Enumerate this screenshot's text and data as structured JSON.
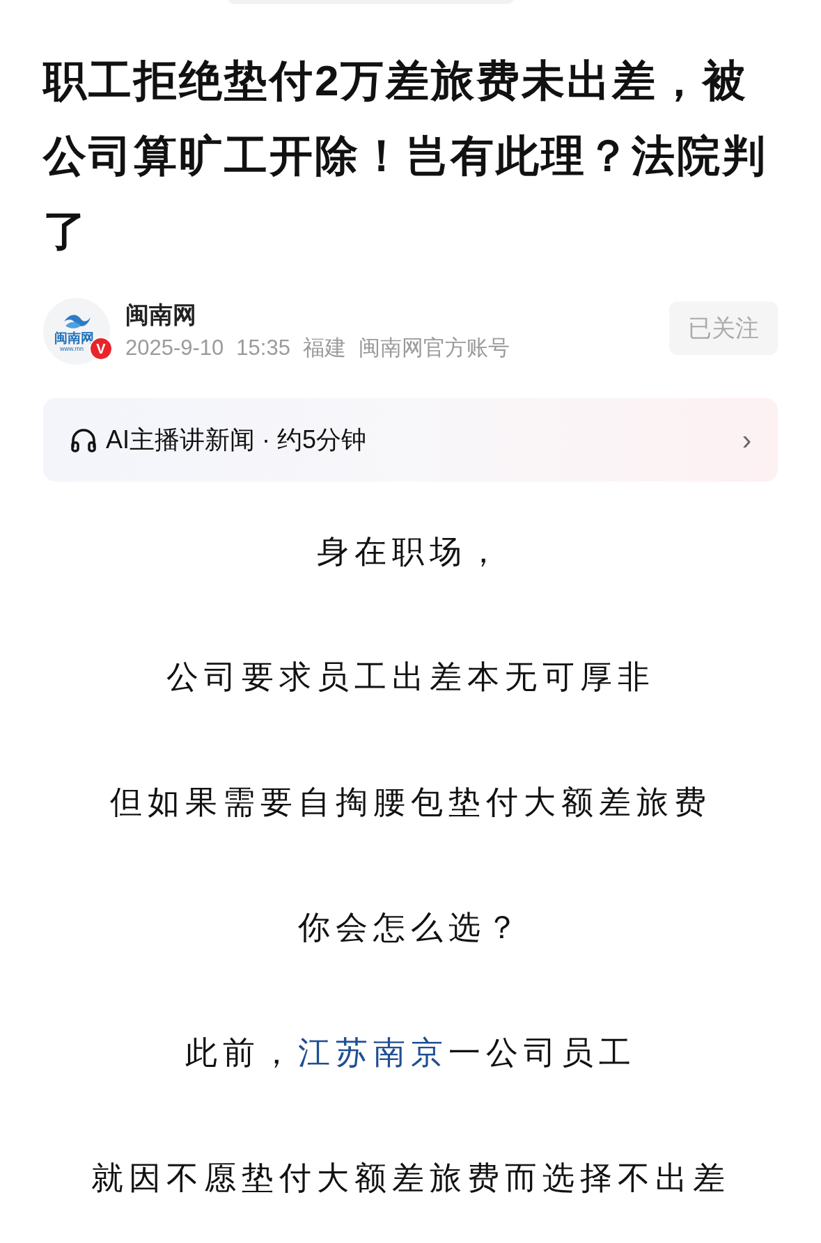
{
  "title": "职工拒绝垫付2万差旅费未出差，被公司算旷工开除！岂有此理？法院判了",
  "author": {
    "logo_text": "闽南网",
    "logo_url": "www.mn",
    "badge": "V",
    "name": "闽南网",
    "date": "2025-9-10",
    "time": "15:35",
    "region": "福建",
    "account": "闽南网官方账号",
    "follow_label": "已关注",
    "followed": true
  },
  "audio_bar": {
    "label": "AI主播讲新闻 · 约5分钟",
    "arrow": "›"
  },
  "paragraphs": [
    {
      "segments": [
        {
          "kind": "text",
          "text": "身在职场，"
        }
      ]
    },
    {
      "segments": [
        {
          "kind": "text",
          "text": "公司要求员工出差本无可厚非"
        }
      ]
    },
    {
      "segments": [
        {
          "kind": "text",
          "text": "但如果需要自掏腰包垫付大额差旅费"
        }
      ]
    },
    {
      "segments": [
        {
          "kind": "text",
          "text": "你会怎么选？"
        }
      ]
    },
    {
      "segments": [
        {
          "kind": "text",
          "text": "此前，"
        },
        {
          "kind": "link",
          "text": "江苏南京"
        },
        {
          "kind": "text",
          "text": "一公司员工"
        }
      ]
    },
    {
      "segments": [
        {
          "kind": "text",
          "text": "就因不愿垫付大额差旅费而选择不出差"
        }
      ]
    }
  ]
}
